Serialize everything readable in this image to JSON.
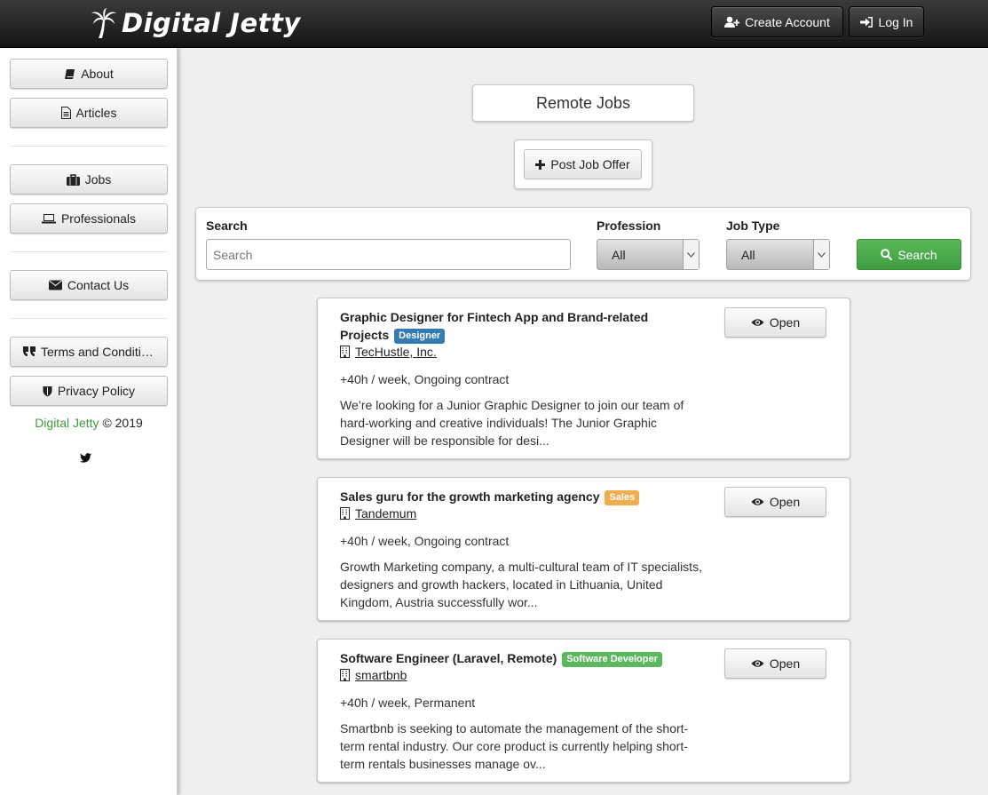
{
  "header": {
    "brand": "Digital Jetty",
    "logo_icon": "palm-tree-icon",
    "create_account_label": "Create Account",
    "login_label": "Log In"
  },
  "sidebar": {
    "items": [
      {
        "label": "About",
        "icon": "book-icon"
      },
      {
        "label": "Articles",
        "icon": "document-icon"
      },
      {
        "label": "Jobs",
        "icon": "briefcase-icon"
      },
      {
        "label": "Professionals",
        "icon": "laptop-icon"
      },
      {
        "label": "Contact Us",
        "icon": "envelope-icon"
      },
      {
        "label": "Terms and Conditions",
        "icon": "quote-icon"
      },
      {
        "label": "Privacy Policy",
        "icon": "shield-icon"
      }
    ],
    "footer_brand": "Digital Jetty",
    "footer_copyright": "© 2019",
    "social_icon": "twitter-icon"
  },
  "main": {
    "page_title": "Remote Jobs",
    "post_job_label": "Post Job Offer"
  },
  "filter": {
    "search_label": "Search",
    "search_placeholder": "Search",
    "search_value": "",
    "profession_label": "Profession",
    "profession_value": "All",
    "job_type_label": "Job Type",
    "job_type_value": "All",
    "search_button_label": "Search",
    "search_button_color": "#4cae4c"
  },
  "jobs": [
    {
      "title": "Graphic Designer for Fintech App and Brand-related Projects",
      "badge": "Designer",
      "badge_color": "#337ab7",
      "company": "TecHustle, Inc.",
      "terms": "+40h / week, Ongoing contract",
      "description": "We’re looking for a Junior Graphic Designer to join our team of hard-working and creative individuals! The Junior Graphic Designer will be responsible for desi...",
      "open_label": "Open"
    },
    {
      "title": "Sales guru for the growth marketing agency",
      "badge": "Sales",
      "badge_color": "#f0ad4e",
      "company": "Tandemum",
      "terms": "+40h / week, Ongoing contract",
      "description": "Growth Marketing company, a multi-cultural team of IT specialists, designers and growth hackers, located in Lithuania, United Kingdom, Austria successfully wor...",
      "open_label": "Open"
    },
    {
      "title": "Software Engineer (Laravel, Remote)",
      "badge": "Software Developer",
      "badge_color": "#5cb85c",
      "company": "smartbnb",
      "terms": "+40h / week, Permanent",
      "description": "Smartbnb is seeking to automate the management of the short-term rental industry. Our core product is currently helping short-term rentals businesses manage ov...",
      "open_label": "Open"
    }
  ]
}
